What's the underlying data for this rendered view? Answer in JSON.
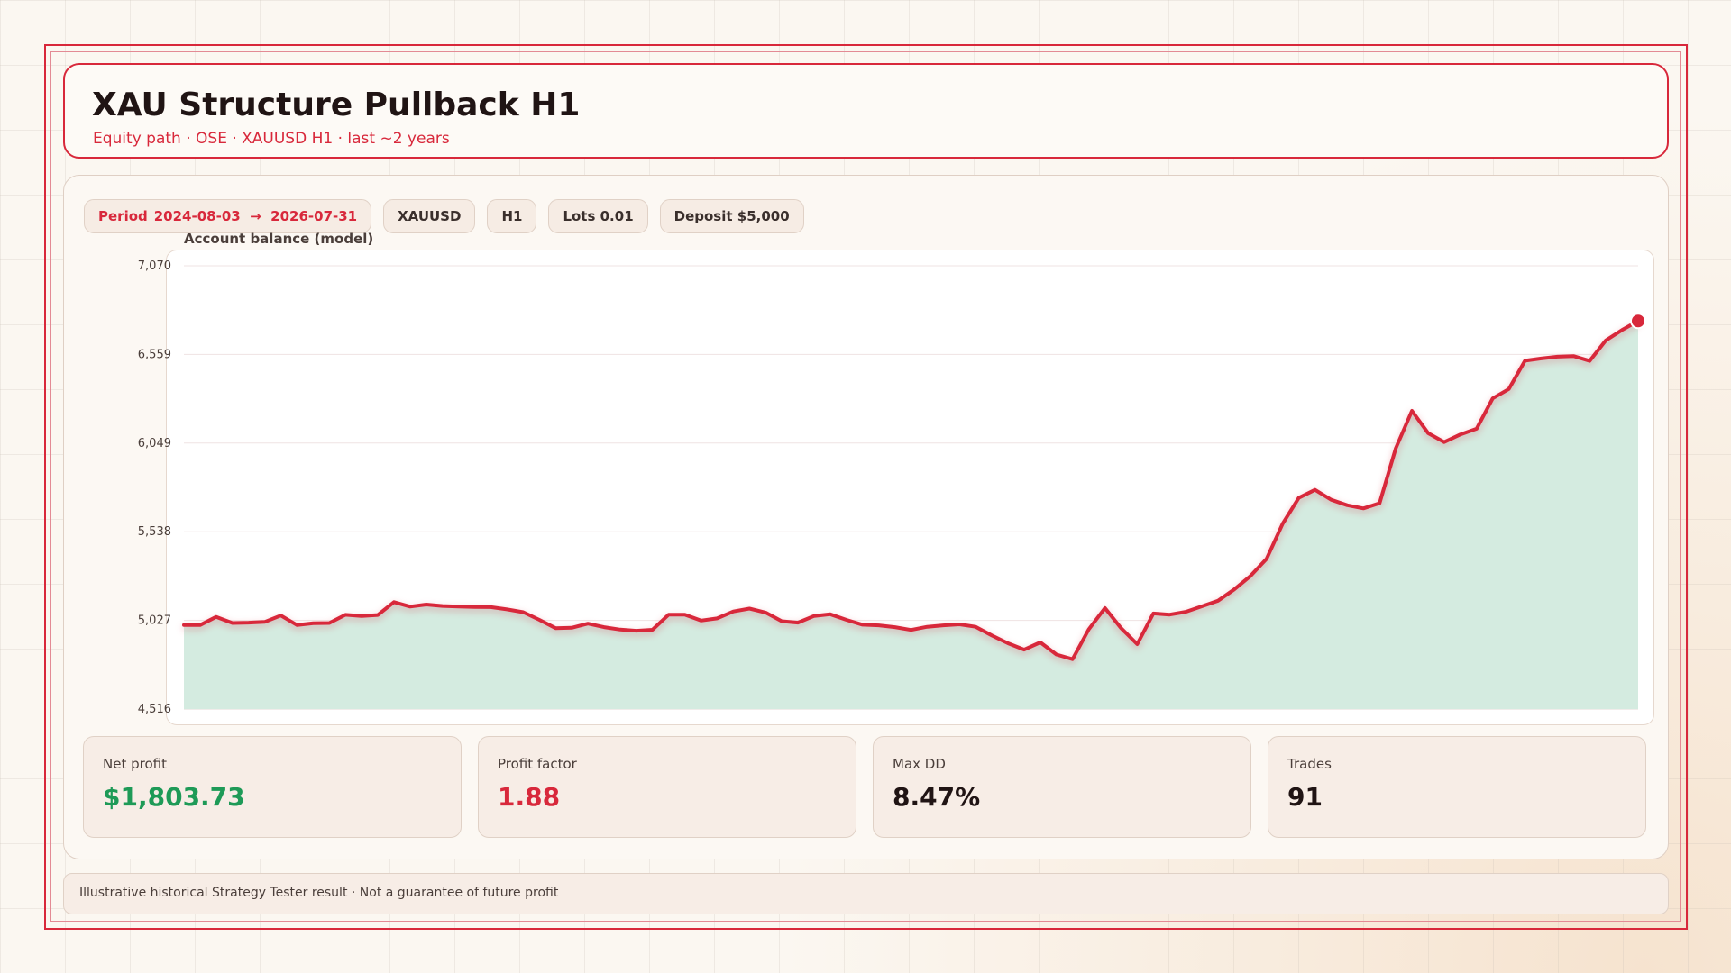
{
  "header": {
    "title": "XAU Structure Pullback H1",
    "subtitle": "Equity path  ·  OSE  ·  XAUUSD H1  ·  last ~2 years"
  },
  "chips": {
    "period_label": "Period",
    "period_value": "2024-08-03  →  2026-07-31",
    "symbol": "XAUUSD",
    "timeframe": "H1",
    "lots": "Lots 0.01",
    "deposit": "Deposit $5,000"
  },
  "stats": [
    {
      "label": "Net profit",
      "value": "$1,803.73"
    },
    {
      "label": "Profit factor",
      "value": "1.88"
    },
    {
      "label": "Max DD",
      "value": "8.47%"
    },
    {
      "label": "Trades",
      "value": "91"
    }
  ],
  "footer": {
    "text": "Illustrative historical Strategy Tester result  ·  Not a guarantee of future profit"
  },
  "colors": {
    "accent": "#d8283b",
    "area_fill": "#d4ebe0",
    "positive": "#1e9a57"
  },
  "chart_data": {
    "type": "area",
    "title": "Account balance (model)",
    "xlabel": "",
    "ylabel": "",
    "ylim": [
      4516,
      7070
    ],
    "yticks": [
      "4,516",
      "5,027",
      "5,538",
      "6,049",
      "6,559",
      "7,070"
    ],
    "grid": true,
    "x": [
      0,
      1,
      2,
      3,
      4,
      5,
      6,
      7,
      8,
      9,
      10,
      11,
      12,
      13,
      14,
      15,
      16,
      17,
      18,
      19,
      20,
      21,
      22,
      23,
      24,
      25,
      26,
      27,
      28,
      29,
      30,
      31,
      32,
      33,
      34,
      35,
      36,
      37,
      38,
      39,
      40,
      41,
      42,
      43,
      44,
      45,
      46,
      47,
      48,
      49,
      50,
      51,
      52,
      53,
      54,
      55,
      56,
      57,
      58,
      59,
      60,
      61,
      62,
      63,
      64,
      65,
      66,
      67,
      68,
      69,
      70,
      71,
      72,
      73,
      74,
      75,
      76,
      77,
      78,
      79,
      80,
      81,
      82,
      83,
      84,
      85,
      86,
      87,
      88,
      89,
      90
    ],
    "series": [
      {
        "values": [
          5000,
          5000,
          5047,
          5012,
          5014,
          5018,
          5055,
          5000,
          5010,
          5012,
          5059,
          5052,
          5058,
          5132,
          5106,
          5118,
          5110,
          5107,
          5104,
          5103,
          5090,
          5074,
          5030,
          4982,
          4984,
          5008,
          4988,
          4974,
          4967,
          4973,
          5060,
          5060,
          5026,
          5038,
          5078,
          5095,
          5072,
          5022,
          5014,
          5052,
          5062,
          5030,
          5002,
          4998,
          4988,
          4972,
          4990,
          4998,
          5004,
          4990,
          4940,
          4895,
          4858,
          4900,
          4830,
          4803,
          4975,
          5098,
          4982,
          4890,
          5067,
          5060,
          5076,
          5108,
          5140,
          5205,
          5282,
          5381,
          5584,
          5733,
          5779,
          5722,
          5690,
          5672,
          5702,
          6019,
          6234,
          6106,
          6054,
          6098,
          6131,
          6306,
          6360,
          6523,
          6536,
          6546,
          6550,
          6522,
          6640,
          6700,
          6752
        ]
      }
    ]
  }
}
